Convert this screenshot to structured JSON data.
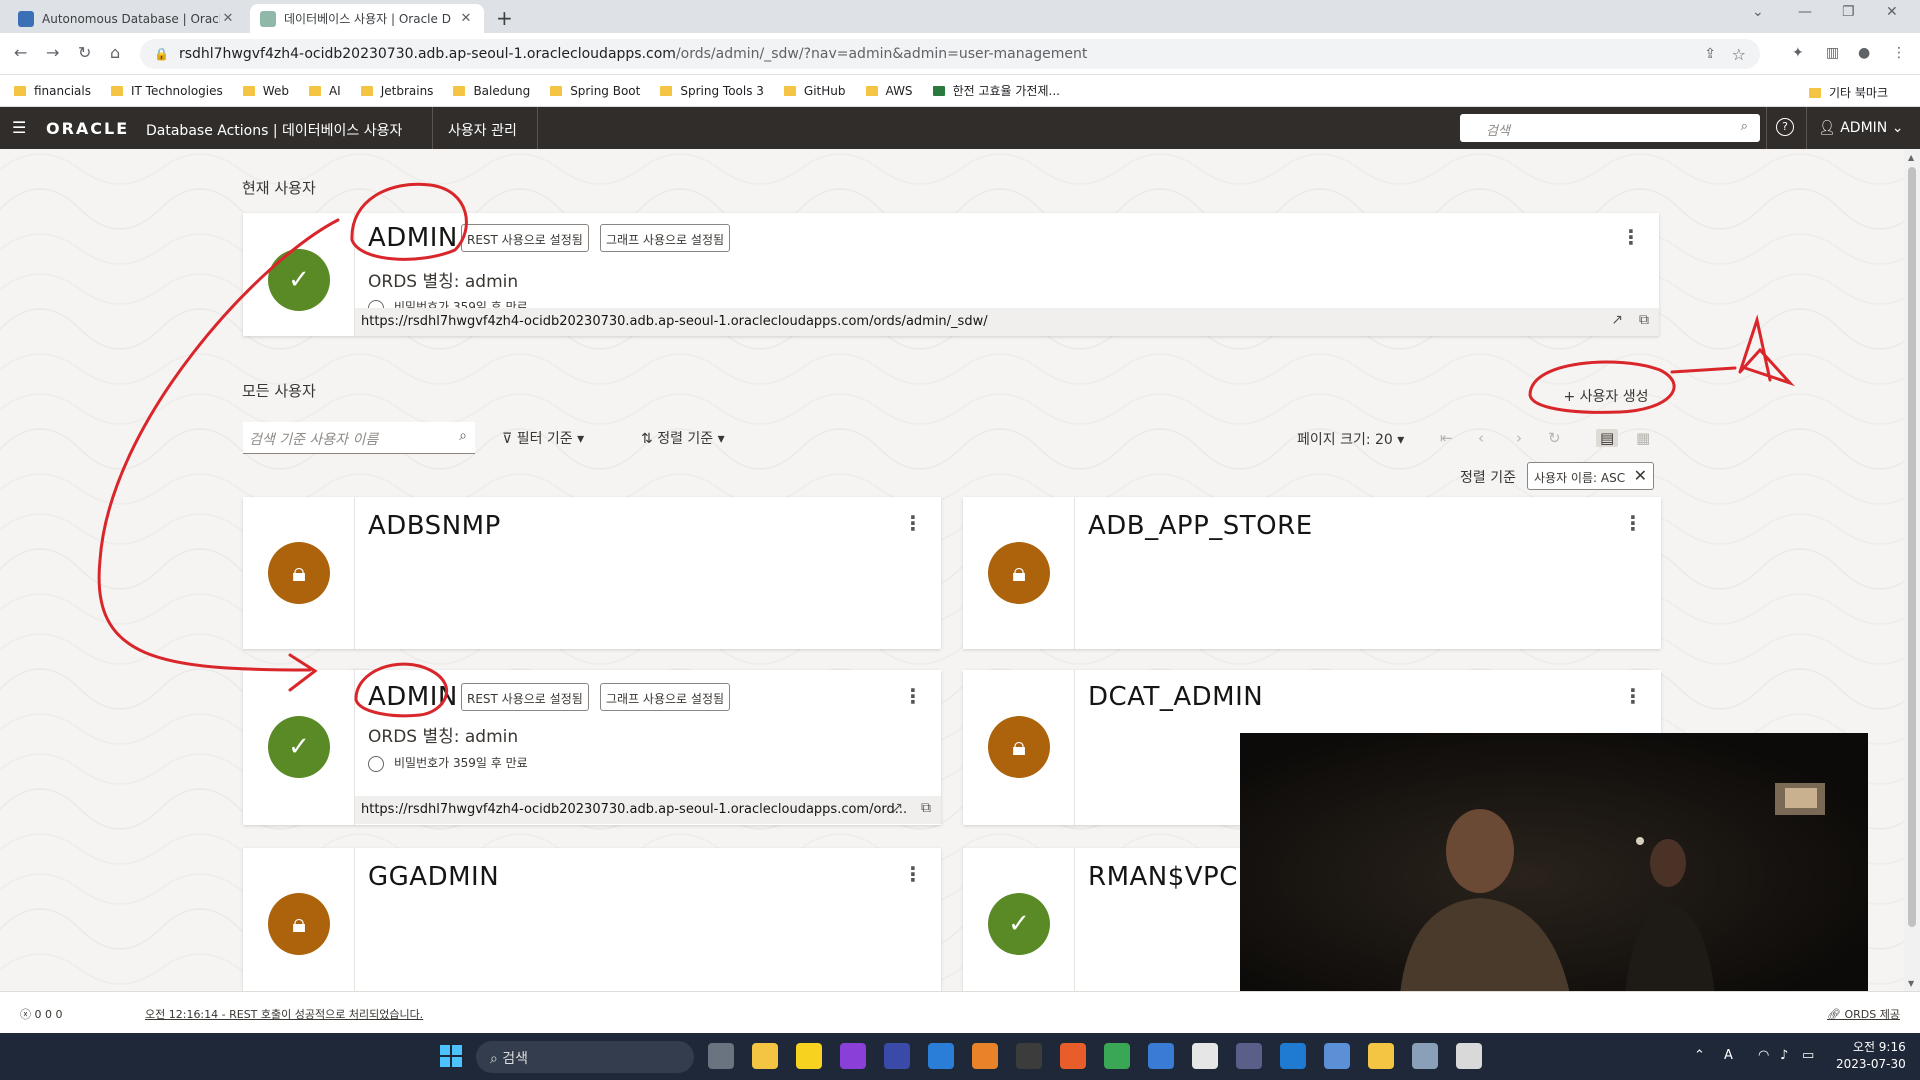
{
  "browser": {
    "tabs": [
      {
        "title": "Autonomous Database | Oracle",
        "active": false
      },
      {
        "title": "데이터베이스 사용자 | Oracle D",
        "active": true
      }
    ],
    "url_host": "rsdhl7hwgvf4zh4-ocidb20230730.adb.ap-seoul-1.oraclecloudapps.com",
    "url_path": "/ords/admin/_sdw/?nav=admin&admin=user-management",
    "bookmarks": [
      "financials",
      "IT Technologies",
      "Web",
      "AI",
      "Jetbrains",
      "Baledung",
      "Spring Boot",
      "Spring Tools 3",
      "GitHub",
      "AWS",
      "한전 고효율 가전제..."
    ],
    "other_bookmarks": "기타 북마크"
  },
  "header": {
    "logo": "ORACLE",
    "app_title": "Database Actions | 데이터베이스 사용자",
    "nav_item": "사용자 관리",
    "search_placeholder": "검색",
    "user": "ADMIN"
  },
  "current_user_section": "현재 사용자",
  "current_user": {
    "name": "ADMIN",
    "badge_rest": "REST 사용으로 설정됨",
    "badge_graph": "그래프 사용으로 설정됨",
    "alias": "ORDS 별칭: admin",
    "expiry": "비밀번호가 359일 후 만료",
    "url": "https://rsdhl7hwgvf4zh4-ocidb20230730.adb.ap-seoul-1.oraclecloudapps.com/ords/admin/_sdw/"
  },
  "all_users_section": "모든 사용자",
  "create_button": "+ 사용자 생성",
  "toolbar": {
    "search_placeholder": "검색 기준 사용자 이름",
    "filter": "필터 기준",
    "sort": "정렬 기준",
    "page_size": "페이지 크기: 20",
    "sort_label": "정렬 기준",
    "sort_chip": "사용자 이름: ASC"
  },
  "users": [
    {
      "name": "ADBSNMP",
      "status": "locked"
    },
    {
      "name": "ADB_APP_STORE",
      "status": "locked"
    },
    {
      "name": "ADMIN",
      "status": "active",
      "badge_rest": "REST 사용으로 설정됨",
      "badge_graph": "그래프 사용으로 설정됨",
      "alias": "ORDS 별칭: admin",
      "expiry": "비밀번호가 359일 후 만료",
      "url": "https://rsdhl7hwgvf4zh4-ocidb20230730.adb.ap-seoul-1.oraclecloudapps.com/ord..."
    },
    {
      "name": "DCAT_ADMIN",
      "status": "locked"
    },
    {
      "name": "GGADMIN",
      "status": "locked"
    },
    {
      "name": "RMAN$VPC",
      "status": "active"
    }
  ],
  "status_bar": {
    "counts": "0  0  0",
    "message": "오전 12:16:14 - REST 호출이 성공적으로 처리되었습니다.",
    "ords": "ORDS 제공"
  },
  "taskbar": {
    "search": "검색",
    "time": "오전 9:16",
    "date": "2023-07-30"
  },
  "colors": {
    "oracle_header": "#312d2a",
    "avatar_active": "#5a8a26",
    "avatar_locked": "#ac630c",
    "annotation": "#d9262b"
  }
}
